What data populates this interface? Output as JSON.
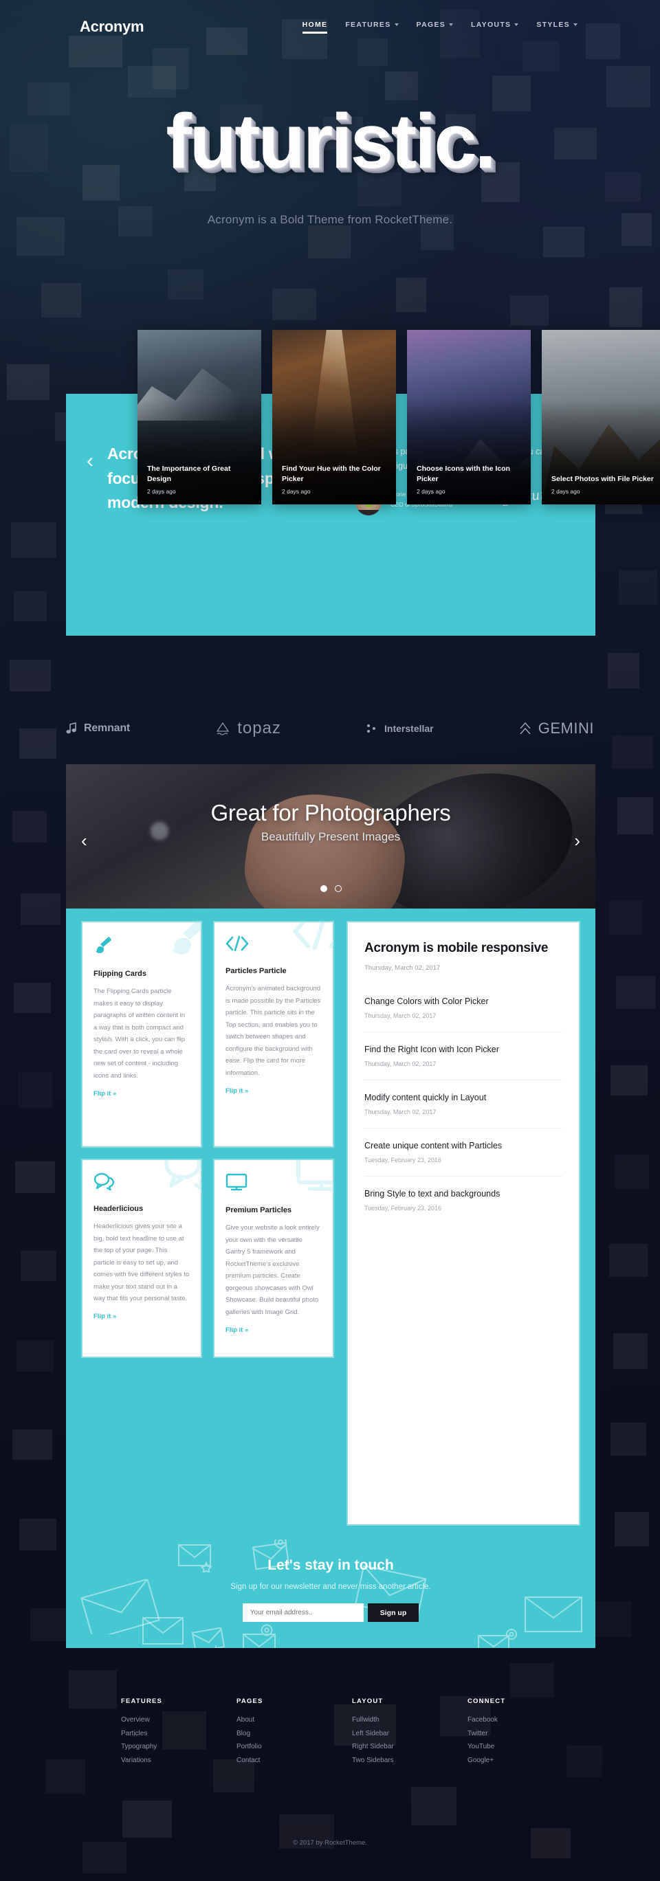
{
  "brand": {
    "logo": "Acronym"
  },
  "nav": {
    "items": [
      {
        "label": "HOME",
        "active": true,
        "caret": false
      },
      {
        "label": "FEATURES",
        "active": false,
        "caret": true
      },
      {
        "label": "PAGES",
        "active": false,
        "caret": true
      },
      {
        "label": "LAYOUTS",
        "active": false,
        "caret": true
      },
      {
        "label": "STYLES",
        "active": false,
        "caret": true
      }
    ]
  },
  "hero": {
    "title": "futuristic.",
    "subtitle": "Acronym is a Bold Theme from RocketTheme."
  },
  "showcase": {
    "prev_icon": "‹",
    "cards": [
      {
        "title": "The Importance of Great Design",
        "date": "2 days ago"
      },
      {
        "title": "Find Your Hue with the Color Picker",
        "date": "2 days ago"
      },
      {
        "title": "Choose Icons with the Icon Picker",
        "date": "2 days ago"
      },
      {
        "title": "Select Photos with File Picker",
        "date": "2 days ago"
      }
    ],
    "heading": "Acronym is designed with a focus on versatility, speed, and modern design.",
    "quote": "Acronym is packed with animated features you can easily configure to meet your needs.",
    "author_name": "Stone Cold Steve Austin",
    "author_role": "CEO of SprocketBeams",
    "signature": "signature",
    "teal": "#45c8d2"
  },
  "brands": [
    {
      "name": "Remnant",
      "icon": "music-note-icon"
    },
    {
      "name": "topaz",
      "icon": "triangle-wave-icon"
    },
    {
      "name": "Interstellar",
      "icon": "dots-icon"
    },
    {
      "name": "GEMINI",
      "icon": "double-chevron-icon"
    }
  ],
  "slider": {
    "title": "Great for Photographers",
    "subtitle": "Beautifully Present Images",
    "prev_icon": "‹",
    "next_icon": "›",
    "dots": 2,
    "active_dot": 0
  },
  "features": {
    "cards": [
      {
        "icon": "paint-brush-icon",
        "title": "Flipping Cards",
        "body": "The Flipping Cards particle makes it easy to display paragraphs of written content in a way that is both compact and stylish. With a click, you can flip the card over to reveal a whole new set of content - including icons and links.",
        "link": "Flip it »"
      },
      {
        "icon": "code-brackets-icon",
        "title": "Particles Particle",
        "body": "Acronym's animated background is made possible by the Particles particle. This particle sits in the Top section, and enables you to switch between shapes and configure the background with ease. Flip the card for more information.",
        "link": "Flip it »"
      },
      {
        "icon": "speech-bubbles-icon",
        "title": "Headerlicious",
        "body": "Headerlicious gives your site a big, bold text headline to use at the top of your page. This particle is easy to set up, and comes with five different styles to make your text stand out in a way that fits your personal taste.",
        "link": "Flip it »"
      },
      {
        "icon": "monitor-icon",
        "title": "Premium Particles",
        "body": "Give your website a look entirely your own with the versatile Gantry 5 framework and RocketTheme's exclusive premium particles. Create gorgeous showcases with Owl Showcase. Build beautiful photo galleries with Image Grid.",
        "link": "Flip it »"
      }
    ]
  },
  "news": {
    "lead_title": "Acronym is mobile responsive",
    "lead_date": "Thursday, March 02, 2017",
    "items": [
      {
        "title": "Change Colors with Color Picker",
        "date": "Thursday, March 02, 2017"
      },
      {
        "title": "Find the Right Icon with Icon Picker",
        "date": "Thursday, March 02, 2017"
      },
      {
        "title": "Modify content quickly in Layout",
        "date": "Thursday, March 02, 2017"
      },
      {
        "title": "Create unique content with Particles",
        "date": "Tuesday, February 23, 2016"
      },
      {
        "title": "Bring Style to text and backgrounds",
        "date": "Tuesday, February 23, 2016"
      }
    ]
  },
  "newsletter": {
    "title": "Let's stay in touch",
    "subtitle": "Sign up for our newsletter and never miss another article.",
    "placeholder": "Your email address..",
    "button": "Sign up"
  },
  "footer": {
    "columns": [
      {
        "heading": "FEATURES",
        "links": [
          "Overview",
          "Particles",
          "Typography",
          "Variations"
        ]
      },
      {
        "heading": "PAGES",
        "links": [
          "About",
          "Blog",
          "Portfolio",
          "Contact"
        ]
      },
      {
        "heading": "LAYOUT",
        "links": [
          "Fullwidth",
          "Left Sidebar",
          "Right Sidebar",
          "Two Sidebars"
        ]
      },
      {
        "heading": "CONNECT",
        "links": [
          "Facebook",
          "Twitter",
          "YouTube",
          "Google+"
        ]
      }
    ],
    "copyright": "© 2017 by RocketTheme."
  }
}
